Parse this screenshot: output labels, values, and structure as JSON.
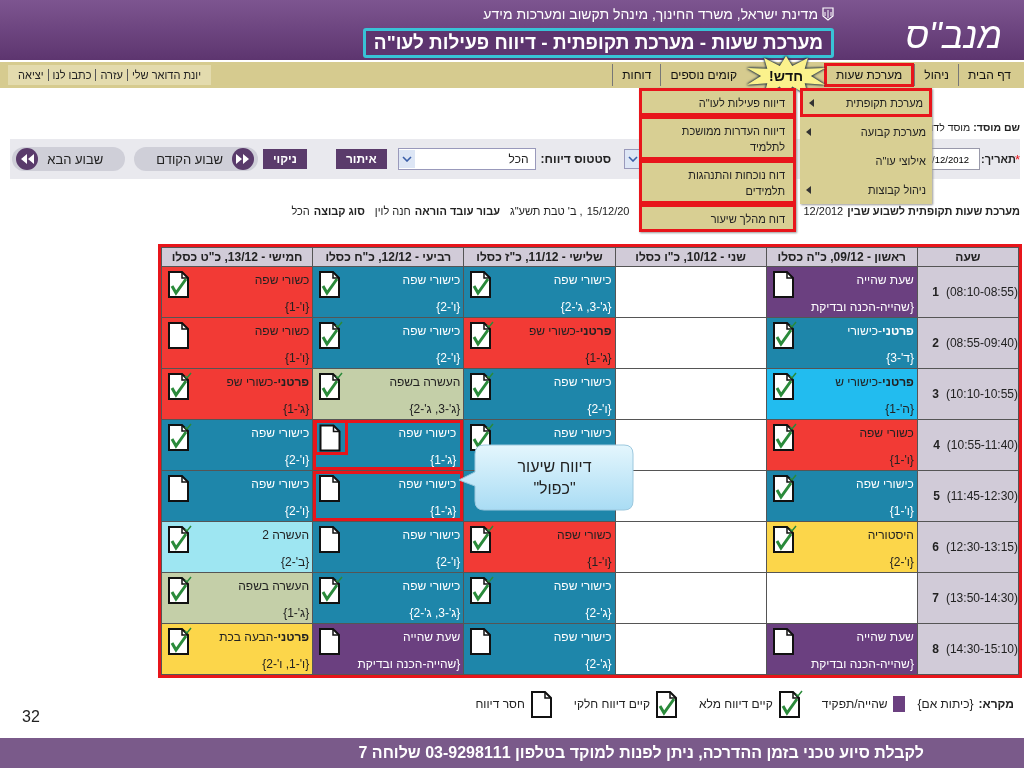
{
  "header": {
    "org_line": "מדינת ישראל, משרד החינוך, מינהל תקשוב ומערכות מידע",
    "logo": "מנב\"ס",
    "page_title": "מערכת שעות - מערכת תקופתית - דיווח פעילות לעו\"ה"
  },
  "nav": {
    "items": [
      {
        "label": "דף הבית",
        "highlighted": false
      },
      {
        "label": "ניהול",
        "highlighted": false
      },
      {
        "label": "מערכת שעות",
        "highlighted": true
      },
      {
        "label": "קומים נוספים",
        "highlighted": false
      },
      {
        "label": "דוחות",
        "highlighted": false
      }
    ],
    "new_badge": "חדש!",
    "links": [
      "יונת הדואר שלי",
      "עזרה",
      "כתבו לנו",
      "יציאה"
    ]
  },
  "menu": {
    "items": [
      {
        "label": "מערכת תקופתית",
        "selected": true,
        "has_submenu": true
      },
      {
        "label": "מערכת קבועה",
        "selected": false,
        "has_submenu": true
      },
      {
        "label": "אילוצי עו\"ה",
        "selected": false,
        "has_submenu": false
      },
      {
        "label": "ניהול קבוצות",
        "selected": false,
        "has_submenu": true
      }
    ],
    "submenu": [
      {
        "label": "דיווח פעילות לעו\"ה",
        "highlighted": true
      },
      {
        "label": "דיווח העדרות ממושכת לתלמיד",
        "highlighted": true
      },
      {
        "label": "דוח נוכחות והתנהגות תלמידים",
        "highlighted": true
      },
      {
        "label": "דוח מהלך שיעור",
        "highlighted": true
      }
    ]
  },
  "institution": {
    "label": "שם מוסד:",
    "value": "מוסד לדו"
  },
  "filters": {
    "required_mark": "*",
    "date_label": "תאריך:",
    "date_value": "/12/2012",
    "status_label": "סטטוס דיווח:",
    "status_value": "הכל",
    "buttons": [
      "איתור",
      "ניקוי"
    ],
    "prev_week": "שבוע הקודם",
    "next_week": "שבוע הבא"
  },
  "info": {
    "title": "מערכת שעות תקופתית לשבוע שבין",
    "start": "12/2012",
    "end": "15/12/20",
    "hebrew_date": ", ב' טבת תשע\"ג",
    "teacher_label": "עבור עובד הוראה",
    "teacher": "חנה לוין",
    "group_label": "סוג קבוצה",
    "group": "הכל"
  },
  "table": {
    "hour_column": "שעה",
    "columns": [
      "ראשון - 09/12, כ\"ה כסלו",
      "שני - 10/12, כ\"ו כסלו",
      "שלישי - 11/12, כ\"ז כסלו",
      "רביעי - 12/12, כ\"ח כסלו",
      "חמישי - 13/12, כ\"ט כסלו"
    ],
    "rows": [
      {
        "number": "1",
        "time": "(08:10-08:55)",
        "cells": [
          {
            "kind": "lesson",
            "subject": "שעת שהייה",
            "group": "{שהייה-הכנה ובדיקת",
            "color": "#6b4080",
            "report": {
              "kind": "missing"
            }
          },
          {
            "kind": "empty"
          },
          {
            "kind": "lesson",
            "subject": "כישורי שפה",
            "group": "{ג'-3, ג'-2}",
            "color": "#1e86aa",
            "report": {
              "kind": "partial"
            }
          },
          {
            "kind": "lesson",
            "subject": "כישורי שפה",
            "group": "{ו'-2}",
            "color": "#1e86aa",
            "report": {
              "kind": "partial"
            }
          },
          {
            "kind": "lesson",
            "subject": "כשורי שפה",
            "group": "{ו'-1}",
            "color": "#f23a35",
            "report": {
              "kind": "partial"
            }
          }
        ]
      },
      {
        "number": "2",
        "time": "(08:55-09:40)",
        "cells": [
          {
            "kind": "lesson",
            "subject": "**פרטני**-כישורי",
            "group": "{ד'-3}",
            "color": "#1e86aa",
            "report": {
              "kind": "full"
            }
          },
          {
            "kind": "empty"
          },
          {
            "kind": "lesson",
            "subject": "**פרטני**-כשורי שפ",
            "group": "{ג'-1}",
            "color": "#f23a35",
            "report": {
              "kind": "full"
            }
          },
          {
            "kind": "lesson",
            "subject": "כישורי שפה",
            "group": "{ו'-2}",
            "color": "#1e86aa",
            "report": {
              "kind": "full"
            }
          },
          {
            "kind": "lesson",
            "subject": "כשורי שפה",
            "group": "{ו'-1}",
            "color": "#f23a35",
            "report": {
              "kind": "missing"
            }
          }
        ]
      },
      {
        "number": "3",
        "time": "(10:10-10:55)",
        "cells": [
          {
            "kind": "lesson",
            "subject": "**פרטני**-כישורי ש",
            "group": "{ה'-1}",
            "color": "#22bcef",
            "report": {
              "kind": "full"
            }
          },
          {
            "kind": "empty"
          },
          {
            "kind": "lesson",
            "subject": "כישורי שפה",
            "group": "{ו'-2}",
            "color": "#1e86aa",
            "report": {
              "kind": "full"
            }
          },
          {
            "kind": "lesson",
            "subject": "העשרה בשפה",
            "group": "{ג'-3, ג'-2}",
            "color": "#c4cfa8",
            "report": {
              "kind": "full"
            }
          },
          {
            "kind": "lesson",
            "subject": "**פרטני**-כשורי שפ",
            "group": "{ג'-1}",
            "color": "#f23a35",
            "report": {
              "kind": "full"
            }
          }
        ]
      },
      {
        "number": "4",
        "time": "(10:55-11:40)",
        "cells": [
          {
            "kind": "lesson",
            "subject": "כשורי שפה",
            "group": "{ו'-1}",
            "color": "#f23a35",
            "report": {
              "kind": "full"
            }
          },
          {
            "kind": "empty"
          },
          {
            "kind": "lesson",
            "subject": "כישורי שפה",
            "color": "#1e86aa",
            "report": {
              "kind": "full"
            }
          },
          {
            "kind": "lesson",
            "subject": "כישורי שפה",
            "group": "{ג'-1}",
            "color": "#1e86aa",
            "highlighted": true,
            "report": {
              "kind": "missing",
              "highlighted": true
            }
          },
          {
            "kind": "lesson",
            "subject": "כישורי שפה",
            "group": "{ו'-2}",
            "color": "#1e86aa",
            "report": {
              "kind": "full"
            }
          }
        ]
      },
      {
        "number": "5",
        "time": "(11:45-12:30)",
        "cells": [
          {
            "kind": "lesson",
            "subject": "כישורי שפה",
            "group": "{ו'-1}",
            "color": "#1e86aa",
            "report": {
              "kind": "full"
            }
          },
          {
            "kind": "empty"
          },
          {
            "kind": "lesson",
            "color": "#1e86aa"
          },
          {
            "kind": "lesson",
            "subject": "כישורי שפה",
            "group": "{ג'-1}",
            "color": "#1e86aa",
            "highlighted": true,
            "report": {
              "kind": "missing"
            }
          },
          {
            "kind": "lesson",
            "subject": "כישורי שפה",
            "group": "{ו'-2}",
            "color": "#1e86aa",
            "report": {
              "kind": "missing"
            }
          }
        ]
      },
      {
        "number": "6",
        "time": "(12:30-13:15)",
        "cells": [
          {
            "kind": "lesson",
            "subject": "היסטוריה",
            "group": "{ו'-2}",
            "color": "#fcd64a",
            "report": {
              "kind": "full"
            }
          },
          {
            "kind": "empty"
          },
          {
            "kind": "lesson",
            "subject": "כשורי שפה",
            "group": "{ו'-1}",
            "color": "#f23a35",
            "report": {
              "kind": "full"
            }
          },
          {
            "kind": "lesson",
            "subject": "כישורי שפה",
            "group": "{ו'-2}",
            "color": "#1e86aa",
            "report": {
              "kind": "missing"
            }
          },
          {
            "kind": "lesson",
            "subject": "העשרה 2",
            "group": "{ב'-2}",
            "color": "#9ee6f2",
            "report": {
              "kind": "full"
            }
          }
        ]
      },
      {
        "number": "7",
        "time": "(13:50-14:30)",
        "cells": [
          {
            "kind": "empty"
          },
          {
            "kind": "empty"
          },
          {
            "kind": "lesson",
            "subject": "כישורי שפה",
            "group": "{ג'-2}",
            "color": "#1e86aa",
            "report": {
              "kind": "full"
            }
          },
          {
            "kind": "lesson",
            "subject": "כישורי שפה",
            "group": "{ג'-3, ג'-2}",
            "color": "#1e86aa",
            "report": {
              "kind": "full"
            }
          },
          {
            "kind": "lesson",
            "subject": "העשרה בשפה",
            "group": "{ג'-1}",
            "color": "#c4cfa8",
            "report": {
              "kind": "full"
            }
          }
        ]
      },
      {
        "number": "8",
        "time": "(14:30-15:10)",
        "cells": [
          {
            "kind": "lesson",
            "subject": "שעת שהייה",
            "group": "{שהייה-הכנה ובדיקת",
            "color": "#6b4080",
            "report": {
              "kind": "missing"
            }
          },
          {
            "kind": "empty"
          },
          {
            "kind": "lesson",
            "subject": "כישורי שפה",
            "group": "{ג'-2}",
            "color": "#1e86aa",
            "report": {
              "kind": "missing"
            }
          },
          {
            "kind": "lesson",
            "subject": "שעת שהייה",
            "group": "{שהייה-הכנה ובדיקת",
            "color": "#6b4080",
            "report": {
              "kind": "missing"
            }
          },
          {
            "kind": "lesson",
            "subject": "**פרטני**-הבעה בכת",
            "group": "{ו'-1, ו'-2}",
            "color": "#fcd64a",
            "report": {
              "kind": "full"
            }
          }
        ]
      }
    ]
  },
  "callout": "דיווח שיעור\n\"כפול\"",
  "legend": {
    "label": "מקרא:",
    "homeroom": "{כיתות אם}",
    "items": [
      {
        "kind": "swatch",
        "label": "שהייה/תפקיד",
        "color": "#6b4080"
      },
      {
        "kind": "full",
        "label": "קיים דיווח מלא"
      },
      {
        "kind": "partial",
        "label": "קיים דיווח חלקי"
      },
      {
        "kind": "missing",
        "label": "חסר דיווח"
      }
    ]
  },
  "slide_number": "32",
  "footer": "לקבלת סיוע טכני בזמן ההדרכה, ניתן לפנות למוקד בטלפון 03-9298111 שלוחה 7"
}
